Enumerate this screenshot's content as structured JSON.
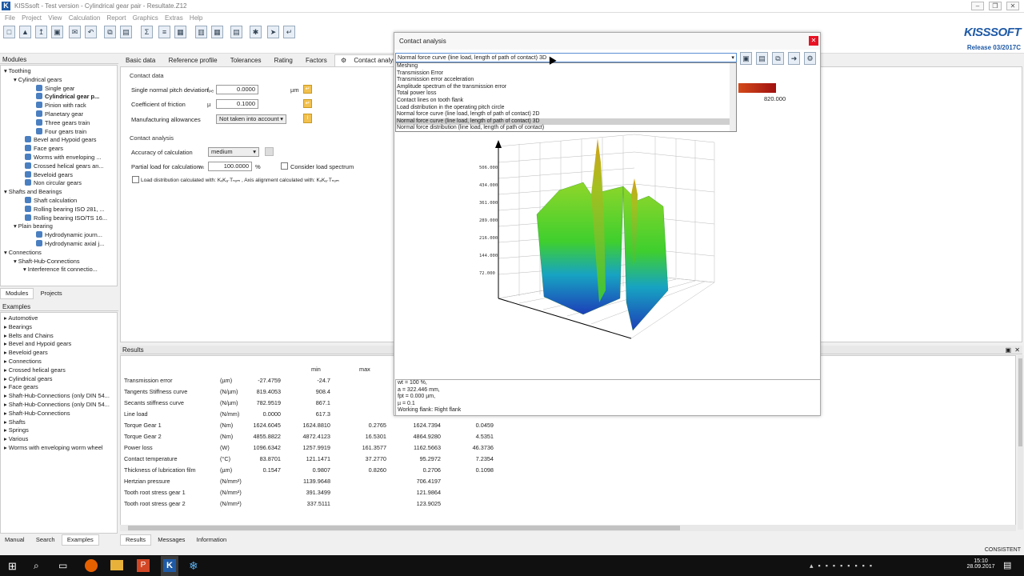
{
  "app": {
    "title": "KISSsoft - Test version - Cylindrical gear pair - Resultate.Z12",
    "brand": "KISSSOFT",
    "release": "Release 03/2017C"
  },
  "menu": [
    "File",
    "Project",
    "View",
    "Calculation",
    "Report",
    "Graphics",
    "Extras",
    "Help"
  ],
  "modules": {
    "title": "Modules",
    "items": [
      {
        "label": "Toothing",
        "lvl": 0,
        "bold": false
      },
      {
        "label": "Cylindrical gears",
        "lvl": 1,
        "bold": false
      },
      {
        "label": "Single gear",
        "lvl": 2,
        "bold": false
      },
      {
        "label": "Cylindrical gear p...",
        "lvl": 2,
        "bold": true
      },
      {
        "label": "Pinion with rack",
        "lvl": 2,
        "bold": false
      },
      {
        "label": "Planetary gear",
        "lvl": 2,
        "bold": false
      },
      {
        "label": "Three gears train",
        "lvl": 2,
        "bold": false
      },
      {
        "label": "Four gears train",
        "lvl": 2,
        "bold": false
      },
      {
        "label": "Bevel and Hypoid gears",
        "lvl": 1,
        "bold": false
      },
      {
        "label": "Face gears",
        "lvl": 1,
        "bold": false
      },
      {
        "label": "Worms with enveloping ...",
        "lvl": 1,
        "bold": false
      },
      {
        "label": "Crossed helical gears an...",
        "lvl": 1,
        "bold": false
      },
      {
        "label": "Beveloid gears",
        "lvl": 1,
        "bold": false
      },
      {
        "label": "Non circular gears",
        "lvl": 1,
        "bold": false
      },
      {
        "label": "Shafts and Bearings",
        "lvl": 0,
        "bold": false
      },
      {
        "label": "Shaft calculation",
        "lvl": 1,
        "bold": false
      },
      {
        "label": "Rolling bearing ISO 281, ...",
        "lvl": 1,
        "bold": false
      },
      {
        "label": "Rolling bearing ISO/TS 16...",
        "lvl": 1,
        "bold": false
      },
      {
        "label": "Plain bearing",
        "lvl": 1,
        "bold": false
      },
      {
        "label": "Hydrodynamic journ...",
        "lvl": 2,
        "bold": false
      },
      {
        "label": "Hydrodynamic axial j...",
        "lvl": 2,
        "bold": false
      },
      {
        "label": "Connections",
        "lvl": 0,
        "bold": false
      },
      {
        "label": "Shaft-Hub-Connections",
        "lvl": 1,
        "bold": false
      },
      {
        "label": "Interference fit connectio...",
        "lvl": 2,
        "bold": false
      }
    ],
    "tabs": [
      "Modules",
      "Projects"
    ]
  },
  "examples": {
    "title": "Examples",
    "items": [
      "Automotive",
      "Bearings",
      "Belts and Chains",
      "Bevel and Hypoid gears",
      "Beveloid gears",
      "Connections",
      "Crossed helical gears",
      "Cylindrical gears",
      "Face gears",
      "Shaft-Hub-Connections (only DIN 54...",
      "Shaft-Hub-Connections (only DIN 54...",
      "Shaft-Hub-Connections",
      "Shafts",
      "Springs",
      "Various",
      "Worms with enveloping worm wheel"
    ],
    "tabs": [
      "Manual",
      "Search",
      "Examples"
    ]
  },
  "tabs": [
    "Basic data",
    "Reference profile",
    "Tolerances",
    "Rating",
    "Factors",
    "Contact analysis"
  ],
  "contact_data": {
    "group": "Contact data",
    "pitch_dev_label": "Single normal pitch deviation",
    "pitch_dev_sym": "fₚₑ",
    "pitch_dev_value": "0.0000",
    "pitch_dev_unit": "µm",
    "friction_label": "Coefficient of friction",
    "friction_sym": "µ",
    "friction_value": "0.1000",
    "allowances_label": "Manufacturing allowances",
    "allowances_value": "Not taken into account"
  },
  "contact_analysis": {
    "group": "Contact analysis",
    "accuracy_label": "Accuracy of calculation",
    "accuracy_value": "medium",
    "partial_label": "Partial load for calculation",
    "partial_sym": "wₜ",
    "partial_value": "100.0000",
    "partial_unit": "%",
    "spectrum_label": "Consider load spectrum",
    "dist_label": "Load distribution calculated with: KᵥKₐ·Tₙₒₘ , Axis alignment calculated with: KᵥKₐ·Tₙₒₘ"
  },
  "results": {
    "title": "Results",
    "col_min": "min",
    "col_max": "max",
    "rows": [
      {
        "name": "Transmission error",
        "unit": "(µm)",
        "c1": "-27.4759",
        "c2": "-24.7",
        "c3": "",
        "c4": "",
        "c5": ""
      },
      {
        "name": "Tangents Stiffness curve",
        "unit": "(N/µm)",
        "c1": "819.4053",
        "c2": "908.4",
        "c3": "",
        "c4": "",
        "c5": ""
      },
      {
        "name": "Secants stiffness curve",
        "unit": "(N/µm)",
        "c1": "782.9519",
        "c2": "867.1",
        "c3": "",
        "c4": "",
        "c5": ""
      },
      {
        "name": "Line load",
        "unit": "(N/mm)",
        "c1": "0.0000",
        "c2": "617.3",
        "c3": "",
        "c4": "",
        "c5": ""
      },
      {
        "name": "Torque Gear 1",
        "unit": "(Nm)",
        "c1": "1624.6045",
        "c2": "1624.8810",
        "c3": "0.2765",
        "c4": "1624.7394",
        "c5": "0.0459"
      },
      {
        "name": "Torque Gear 2",
        "unit": "(Nm)",
        "c1": "4855.8822",
        "c2": "4872.4123",
        "c3": "16.5301",
        "c4": "4864.9280",
        "c5": "4.5351"
      },
      {
        "name": "Power loss",
        "unit": "(W)",
        "c1": "1096.6342",
        "c2": "1257.9919",
        "c3": "161.3577",
        "c4": "1162.5663",
        "c5": "46.3736"
      },
      {
        "name": "Contact temperature",
        "unit": "(°C)",
        "c1": "83.8701",
        "c2": "121.1471",
        "c3": "37.2770",
        "c4": "95.2972",
        "c5": "7.2354"
      },
      {
        "name": "Thickness of lubrication film",
        "unit": "(µm)",
        "c1": "0.1547",
        "c2": "0.9807",
        "c3": "0.8260",
        "c4": "0.2706",
        "c5": "0.1098"
      },
      {
        "name": "Hertzian pressure",
        "unit": "(N/mm²)",
        "c1": "",
        "c2": "1139.9648",
        "c3": "",
        "c4": "706.4197",
        "c5": ""
      },
      {
        "name": "Tooth root stress gear 1",
        "unit": "(N/mm²)",
        "c1": "",
        "c2": "391.3499",
        "c3": "",
        "c4": "121.9864",
        "c5": ""
      },
      {
        "name": "Tooth root stress gear 2",
        "unit": "(N/mm²)",
        "c1": "",
        "c2": "337.5111",
        "c3": "",
        "c4": "123.9025",
        "c5": ""
      }
    ],
    "tabs": [
      "Results",
      "Messages",
      "Information"
    ]
  },
  "dialog": {
    "title": "Contact analysis",
    "selected": "Normal force curve (line load, length of path of contact) 3D",
    "options": [
      "Meshing",
      "Transmission Error",
      "Transmission error acceleration",
      "Amplitude spectrum of the transmission error",
      "Total power loss",
      "Contact lines on tooth flank",
      "Load distribution in the operating pitch circle",
      "Normal force curve (line load, length of path of contact) 2D",
      "Normal force curve (line load, length of path of contact) 3D",
      "Normal force distribution (line load, length of path of contact)"
    ],
    "highlight_index": 8,
    "legend_value": "820.000",
    "info": [
      "wt = 100 %,",
      "a = 322.446 mm,",
      "fpt = 0.000 µm,",
      "µ = 0.1",
      "Working flank: Right flank"
    ]
  },
  "status": {
    "text": "CONSISTENT"
  },
  "clock": {
    "time": "15:10",
    "date": "28.09.2017"
  },
  "colors": {
    "accent": "#1f5aa6",
    "highlight": "#cfcfcf",
    "close": "#e81123"
  }
}
